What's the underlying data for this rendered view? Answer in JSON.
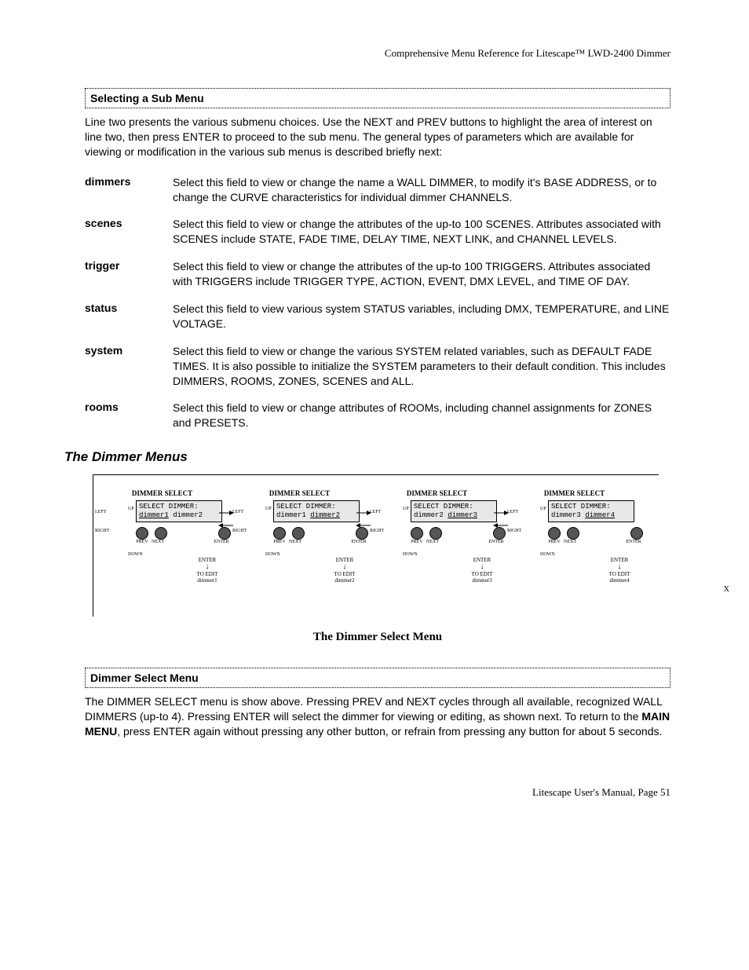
{
  "header": "Comprehensive Menu Reference for Litescape™ LWD-2400 Dimmer",
  "sec1": {
    "title": "Selecting a Sub Menu",
    "intro": "Line two presents the various submenu choices. Use the NEXT and PREV buttons to highlight the area of interest on line two, then press ENTER to proceed to the sub menu. The general types of parameters which are available for viewing or modification in the various sub menus is described briefly next:",
    "defs": [
      {
        "term": "dimmers",
        "desc": "Select this field to view or change the name a WALL DIMMER, to modify it's BASE ADDRESS, or to change the CURVE characteristics for individual dimmer CHANNELS."
      },
      {
        "term": "scenes",
        "desc": "Select this field to view or change the attributes of the up-to 100 SCENES. Attributes associated with SCENES include STATE, FADE TIME, DELAY TIME, NEXT LINK, and CHANNEL LEVELS."
      },
      {
        "term": "trigger",
        "desc": "Select this field to view or change the attributes of the up-to 100 TRIGGERS. Attributes associated with TRIGGERS include TRIGGER TYPE, ACTION, EVENT, DMX LEVEL, and TIME OF DAY."
      },
      {
        "term": "status",
        "desc": "Select this field to view various system STATUS variables, including DMX, TEMPERATURE, and LINE VOLTAGE."
      },
      {
        "term": "system",
        "desc": "Select this field to view or change the various SYSTEM related variables, such as DEFAULT FADE TIMES. It is also possible to initialize the SYSTEM parameters to their default condition. This includes DIMMERS, ROOMS, ZONES, SCENES and ALL."
      },
      {
        "term": "rooms",
        "desc": "Select this field to view or change attributes of ROOMs, including channel assignments for ZONES and PRESETS."
      }
    ]
  },
  "heading2": "The Dimmer Menus",
  "diagram": {
    "panel_title": "DIMMER SELECT",
    "left_label": "LEFT",
    "right_label": "RIGHT",
    "up_label": "UP",
    "down_label": "DOWN",
    "prev_label": "PREV",
    "next_label": "NEXT",
    "enter_label": "ENTER",
    "panels": [
      {
        "line1": "SELECT DIMMER:",
        "d1": "dimmer1",
        "d2": "dimmer2",
        "edit": "TO EDIT",
        "target": "dimmer1"
      },
      {
        "line1": "SELECT DIMMER:",
        "d1": "dimmer1",
        "d2": "dimmer2",
        "edit": "TO EDIT",
        "target": "dimmer2"
      },
      {
        "line1": "SELECT DIMMER:",
        "d1": "dimmer2",
        "d2": "dimmer3",
        "edit": "TO EDIT",
        "target": "dimmer3"
      },
      {
        "line1": "SELECT DIMMER:",
        "d1": "dimmer3",
        "d2": "dimmer4",
        "edit": "TO EDIT",
        "target": "dimmer4"
      }
    ],
    "caption": "The Dimmer Select Menu",
    "x": "X"
  },
  "sec2": {
    "title": "Dimmer Select Menu",
    "body_pre": "The DIMMER SELECT menu is show above. Pressing PREV and NEXT cycles through all available, recognized WALL DIMMERS (up-to 4). Pressing ENTER will select the dimmer for viewing or editing, as shown next. To return to the ",
    "body_bold": "MAIN MENU",
    "body_post": ", press ENTER again without pressing any other button, or refrain from pressing any button for about 5 seconds."
  },
  "footer": "Litescape User's Manual, Page 51"
}
